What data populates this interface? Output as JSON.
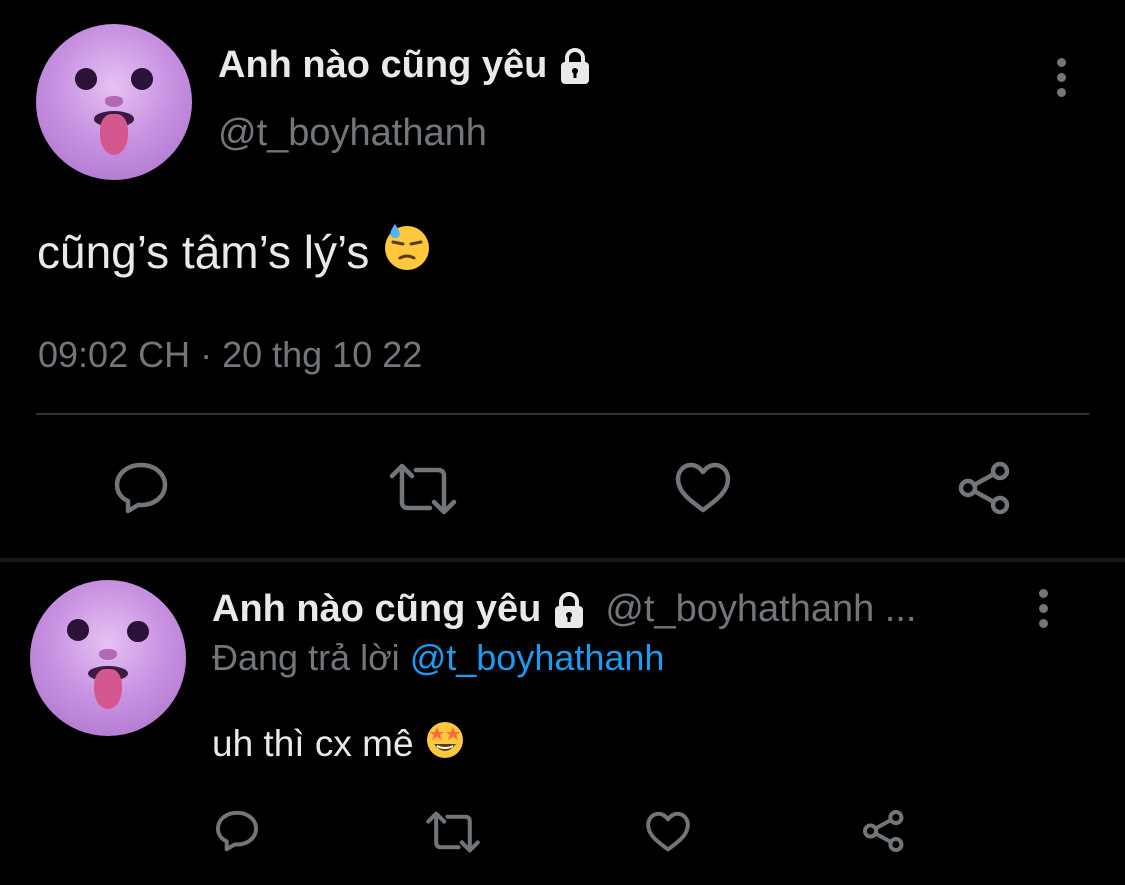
{
  "main_tweet": {
    "display_name": "Anh nào cũng yêu",
    "handle": "@t_boyhathanh",
    "text": "cũng’s tâm’s lý’s",
    "emoji": "downcast-face-with-sweat",
    "timestamp": "09:02 CH · 20 thg 10 22",
    "actions": [
      "reply-icon",
      "retweet-icon",
      "like-icon",
      "share-icon"
    ]
  },
  "reply_tweet": {
    "display_name": "Anh nào cũng yêu",
    "handle": "@t_boyhathanh ...",
    "replying_label": "Đang trả lời",
    "replying_to": "@t_boyhathanh",
    "text": "uh thì cx mê",
    "emoji": "star-struck-face",
    "actions": [
      "reply-icon",
      "retweet-icon",
      "like-icon",
      "share-icon"
    ]
  },
  "colors": {
    "background": "#000000",
    "primary_text": "#e7e9ea",
    "secondary_text": "#71767b",
    "link": "#1d9bf0",
    "divider": "#2f3336",
    "avatar_tint": "#c993e2"
  }
}
